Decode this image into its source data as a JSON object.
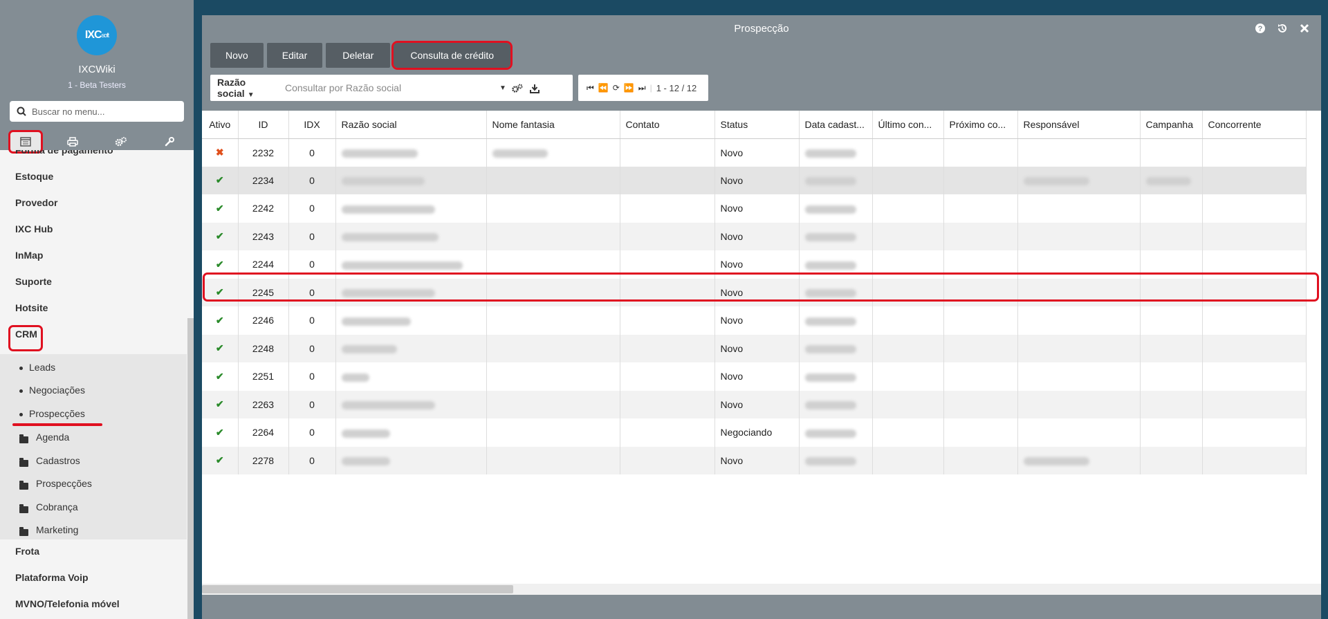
{
  "sidebar": {
    "app_title": "IXCWiki",
    "app_subtitle": "1 - Beta Testers",
    "logo_text": "IXC",
    "logo_suffix": "soft",
    "search_placeholder": "Buscar no menu...",
    "cut_item": "Forma de pagamento",
    "items": [
      "Estoque",
      "Provedor",
      "IXC Hub",
      "InMap",
      "Suporte",
      "Hotsite",
      "CRM"
    ],
    "crm_sub": [
      "Leads",
      "Negociações",
      "Prospecções"
    ],
    "crm_folders": [
      "Agenda",
      "Cadastros",
      "Prospecções",
      "Cobrança",
      "Marketing"
    ],
    "after_items": [
      "Frota",
      "Plataforma Voip",
      "MVNO/Telefonia móvel"
    ]
  },
  "window": {
    "title": "Prospecção",
    "toolbar": {
      "new": "Novo",
      "edit": "Editar",
      "delete": "Deletar",
      "credit": "Consulta de crédito"
    },
    "filter": {
      "field": "Razão social",
      "placeholder": "Consultar por Razão social"
    },
    "pager": {
      "range": "1 - 12 / 12"
    }
  },
  "table": {
    "headers": [
      "Ativo",
      "ID",
      "IDX",
      "Razão social",
      "Nome fantasia",
      "Contato",
      "Status",
      "Data cadast...",
      "Último con...",
      "Próximo co...",
      "Responsável",
      "Campanha",
      "Concorrente"
    ],
    "rows": [
      {
        "active": false,
        "id": "2232",
        "idx": "0",
        "status": "Novo"
      },
      {
        "active": true,
        "id": "2234",
        "idx": "0",
        "status": "Novo"
      },
      {
        "active": true,
        "id": "2242",
        "idx": "0",
        "status": "Novo"
      },
      {
        "active": true,
        "id": "2243",
        "idx": "0",
        "status": "Novo"
      },
      {
        "active": true,
        "id": "2244",
        "idx": "0",
        "status": "Novo"
      },
      {
        "active": true,
        "id": "2245",
        "idx": "0",
        "status": "Novo"
      },
      {
        "active": true,
        "id": "2246",
        "idx": "0",
        "status": "Novo"
      },
      {
        "active": true,
        "id": "2248",
        "idx": "0",
        "status": "Novo"
      },
      {
        "active": true,
        "id": "2251",
        "idx": "0",
        "status": "Novo"
      },
      {
        "active": true,
        "id": "2263",
        "idx": "0",
        "status": "Novo"
      },
      {
        "active": true,
        "id": "2264",
        "idx": "0",
        "status": "Negociando"
      },
      {
        "active": true,
        "id": "2278",
        "idx": "0",
        "status": "Novo"
      }
    ]
  },
  "colors": {
    "header_bg": "#828c93",
    "button_bg": "#565e64",
    "highlight": "#e01020",
    "check": "#2a8a2a",
    "cross": "#e0501c",
    "logo": "#1f96d8"
  }
}
